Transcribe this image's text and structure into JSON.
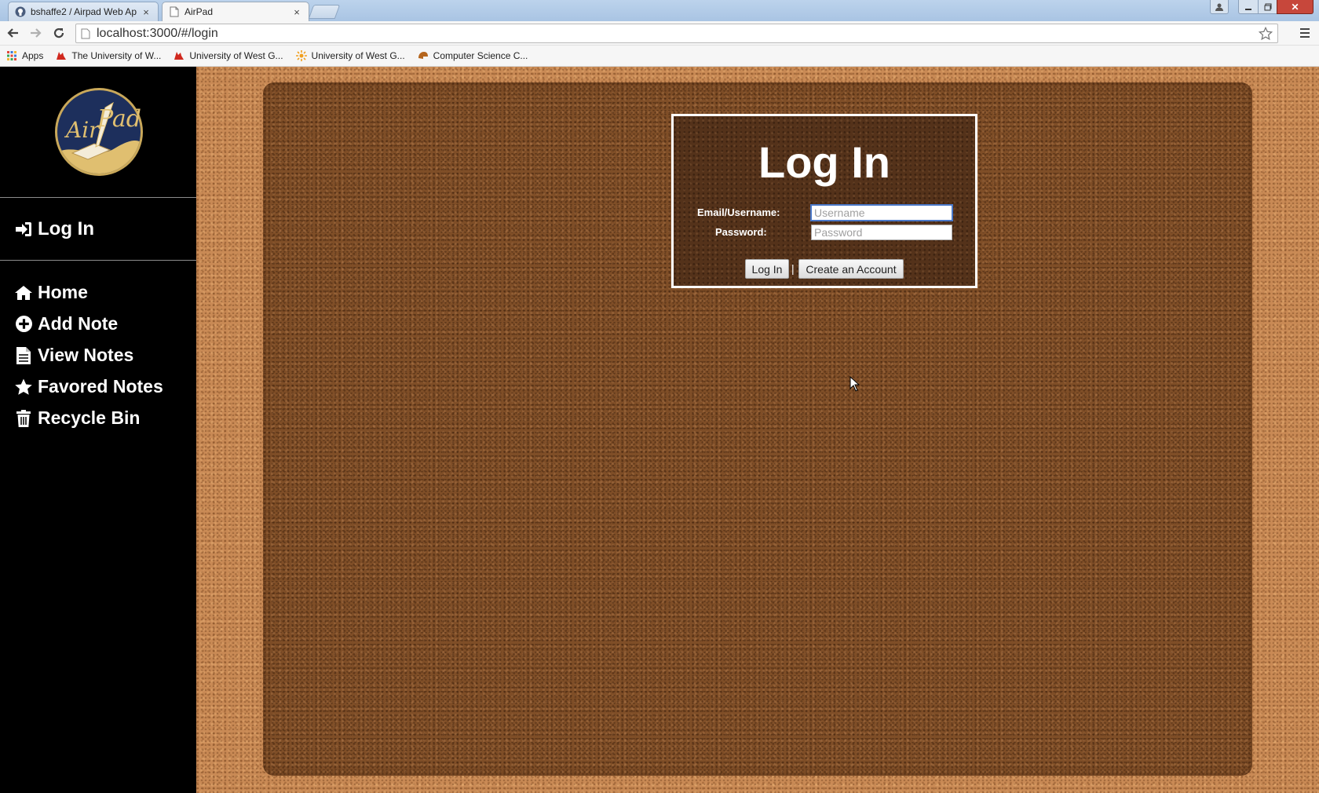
{
  "browser": {
    "tabs": [
      {
        "title": "bshaffe2 / Airpad Web Ap",
        "close": "×",
        "icon": "github-icon",
        "active": false
      },
      {
        "title": "AirPad",
        "close": "×",
        "icon": "page-icon",
        "active": true
      }
    ],
    "address": "localhost:3000/#/login",
    "bookmarks": [
      {
        "label": "Apps",
        "icon": "apps-grid-icon"
      },
      {
        "label": "The University of W...",
        "icon": "wolf-icon"
      },
      {
        "label": "University of West G...",
        "icon": "wolf-icon"
      },
      {
        "label": "University of West G...",
        "icon": "sun-icon"
      },
      {
        "label": "Computer Science C...",
        "icon": "helmet-icon"
      }
    ],
    "window_close": "✕"
  },
  "sidebar": {
    "logo_text": "AirPad",
    "login": {
      "label": "Log In",
      "icon": "sign-in-icon"
    },
    "nav": [
      {
        "label": "Home",
        "icon": "home-icon"
      },
      {
        "label": "Add Note",
        "icon": "plus-circle-icon"
      },
      {
        "label": "View Notes",
        "icon": "file-text-icon"
      },
      {
        "label": "Favored Notes",
        "icon": "star-icon"
      },
      {
        "label": "Recycle Bin",
        "icon": "trash-icon"
      }
    ]
  },
  "login_form": {
    "title": "Log In",
    "username_label": "Email/Username:",
    "username_placeholder": "Username",
    "username_value": "",
    "password_label": "Password:",
    "password_placeholder": "Password",
    "password_value": "",
    "login_button": "Log In",
    "separator": "|",
    "create_button": "Create an Account"
  },
  "colors": {
    "sidebar_bg": "#000000",
    "cork": "#c98a55",
    "board": "#7f4e27",
    "panel": "#54321a",
    "logo_navy": "#1d2f5c",
    "logo_gold": "#e0bf70"
  }
}
